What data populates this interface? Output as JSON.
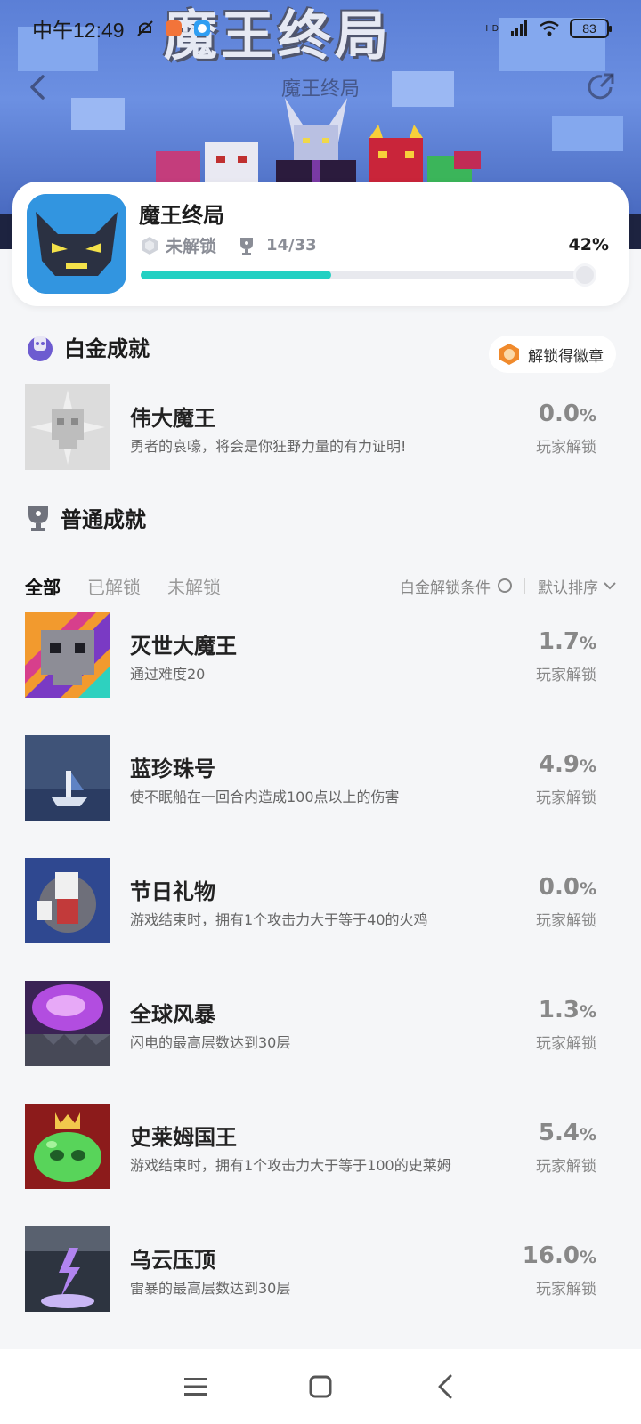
{
  "status_bar": {
    "time": "中午12:49",
    "battery": "83",
    "network": "HD"
  },
  "header": {
    "title": "魔王终局",
    "banner_text": "魔王终局"
  },
  "game": {
    "name": "魔王终局",
    "lock_status": "未解锁",
    "trophy_count": "14/33",
    "percent": "42%",
    "progress": 0.42
  },
  "platinum": {
    "section_title": "白金成就",
    "badge_button": "解锁得徽章",
    "item": {
      "name": "伟大魔王",
      "desc": "勇者的哀嚎，将会是你狂野力量的有力证明!",
      "pct": "0.0",
      "pct_unit": "%",
      "pct_label": "玩家解锁"
    }
  },
  "normal": {
    "section_title": "普通成就",
    "tabs": [
      "全部",
      "已解锁",
      "未解锁"
    ],
    "condition_label": "白金解锁条件",
    "sort_label": "默认排序",
    "items": [
      {
        "name": "灭世大魔王",
        "desc": "通过难度20",
        "pct": "1.7",
        "pct_unit": "%",
        "pct_label": "玩家解锁"
      },
      {
        "name": "蓝珍珠号",
        "desc": "使不眠船在一回合内造成100点以上的伤害",
        "pct": "4.9",
        "pct_unit": "%",
        "pct_label": "玩家解锁"
      },
      {
        "name": "节日礼物",
        "desc": "游戏结束时，拥有1个攻击力大于等于40的火鸡",
        "pct": "0.0",
        "pct_unit": "%",
        "pct_label": "玩家解锁"
      },
      {
        "name": "全球风暴",
        "desc": "闪电的最高层数达到30层",
        "pct": "1.3",
        "pct_unit": "%",
        "pct_label": "玩家解锁"
      },
      {
        "name": "史莱姆国王",
        "desc": "游戏结束时，拥有1个攻击力大于等于100的史莱姆",
        "pct": "5.4",
        "pct_unit": "%",
        "pct_label": "玩家解锁"
      },
      {
        "name": "乌云压顶",
        "desc": "雷暴的最高层数达到30层",
        "pct": "16.0",
        "pct_unit": "%",
        "pct_label": "玩家解锁"
      }
    ]
  },
  "icons": [
    "back-icon",
    "share-icon",
    "trophy-icon",
    "lock-icon",
    "platinum-icon",
    "badge-icon",
    "menu-icon",
    "home-icon",
    "nav-back-icon"
  ]
}
